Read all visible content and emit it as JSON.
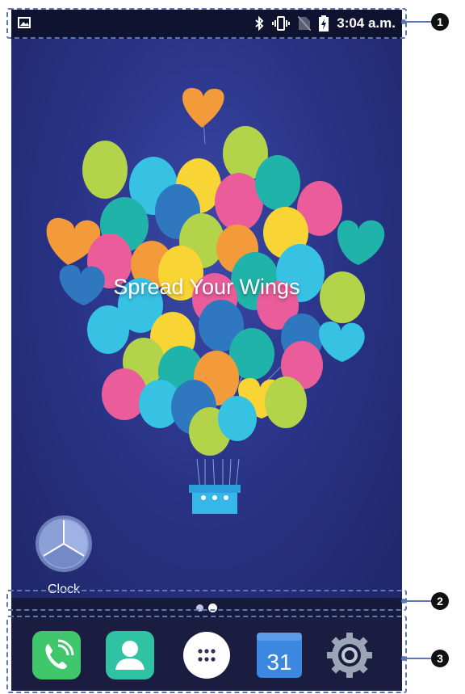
{
  "status_bar": {
    "time": "3:04 a.m.",
    "icons": [
      "image-icon",
      "bluetooth-icon",
      "vibrate-icon",
      "no-sim-icon",
      "battery-charging-icon"
    ]
  },
  "wallpaper": {
    "tagline": "Spread Your Wings"
  },
  "widgets": {
    "clock_label": "Clock"
  },
  "page_indicator": {
    "pages": 2,
    "active_page": 2
  },
  "dock": {
    "apps": [
      {
        "name": "phone-app-icon"
      },
      {
        "name": "contacts-app-icon"
      },
      {
        "name": "app-drawer-icon"
      },
      {
        "name": "calendar-app-icon",
        "date": "31"
      },
      {
        "name": "settings-app-icon"
      }
    ]
  },
  "callouts": [
    "1",
    "2",
    "3"
  ]
}
